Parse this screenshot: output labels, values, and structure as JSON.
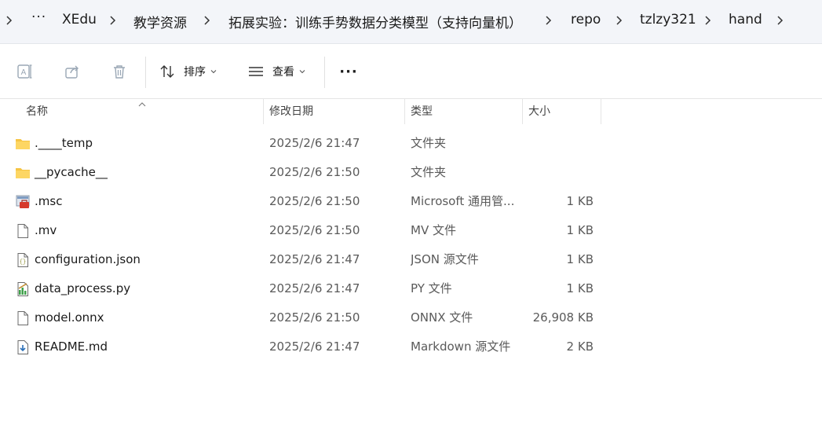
{
  "breadcrumb": {
    "more": "···",
    "items": [
      "XEdu",
      "教学资源",
      "拓展实验：训练手势数据分类模型（支持向量机）",
      "repo",
      "tzlzy321",
      "hand"
    ]
  },
  "toolbar": {
    "rename_icon": "rename-icon",
    "share_icon": "share-icon",
    "delete_icon": "trash-icon",
    "sort_label": "排序",
    "view_label": "查看",
    "more_label": "···"
  },
  "columns": {
    "name": "名称",
    "date": "修改日期",
    "type": "类型",
    "size": "大小"
  },
  "files": [
    {
      "name": ".____temp",
      "date": "2025/2/6 21:47",
      "type": "文件夹",
      "size": "",
      "icon": "folder-icon"
    },
    {
      "name": "__pycache__",
      "date": "2025/2/6 21:50",
      "type": "文件夹",
      "size": "",
      "icon": "folder-icon"
    },
    {
      "name": ".msc",
      "date": "2025/2/6 21:50",
      "type": "Microsoft 通用管...",
      "size": "1 KB",
      "icon": "msc-icon"
    },
    {
      "name": ".mv",
      "date": "2025/2/6 21:50",
      "type": "MV 文件",
      "size": "1 KB",
      "icon": "file-icon"
    },
    {
      "name": "configuration.json",
      "date": "2025/2/6 21:47",
      "type": "JSON 源文件",
      "size": "1 KB",
      "icon": "json-file-icon"
    },
    {
      "name": "data_process.py",
      "date": "2025/2/6 21:47",
      "type": "PY 文件",
      "size": "1 KB",
      "icon": "python-file-icon"
    },
    {
      "name": "model.onnx",
      "date": "2025/2/6 21:50",
      "type": "ONNX 文件",
      "size": "26,908 KB",
      "icon": "file-icon"
    },
    {
      "name": "README.md",
      "date": "2025/2/6 21:47",
      "type": "Markdown 源文件",
      "size": "2 KB",
      "icon": "markdown-file-icon"
    }
  ],
  "colors": {
    "folder": "#f6c443",
    "accent": "#0067c0",
    "addressbar": "#f3f5f9"
  }
}
